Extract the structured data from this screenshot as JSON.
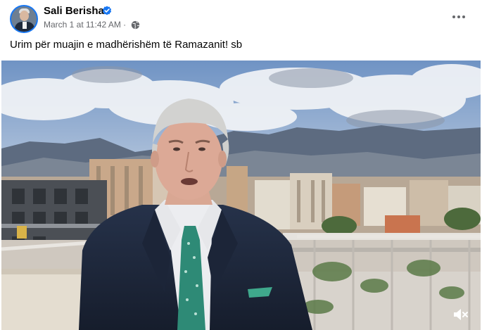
{
  "post": {
    "author_name": "Sali Berisha",
    "timestamp": "March 1 at 11:42 AM",
    "separator": " · ",
    "caption": "Urim për muajin e madhërishëm të Ramazanit! sb"
  },
  "icons": {
    "verified": "verified-badge-icon",
    "privacy": "globe-icon",
    "more": "more-options-icon",
    "sound": "volume-muted-icon"
  },
  "colors": {
    "accent": "#1877f2",
    "text_primary": "#050505",
    "text_secondary": "#65676b"
  }
}
